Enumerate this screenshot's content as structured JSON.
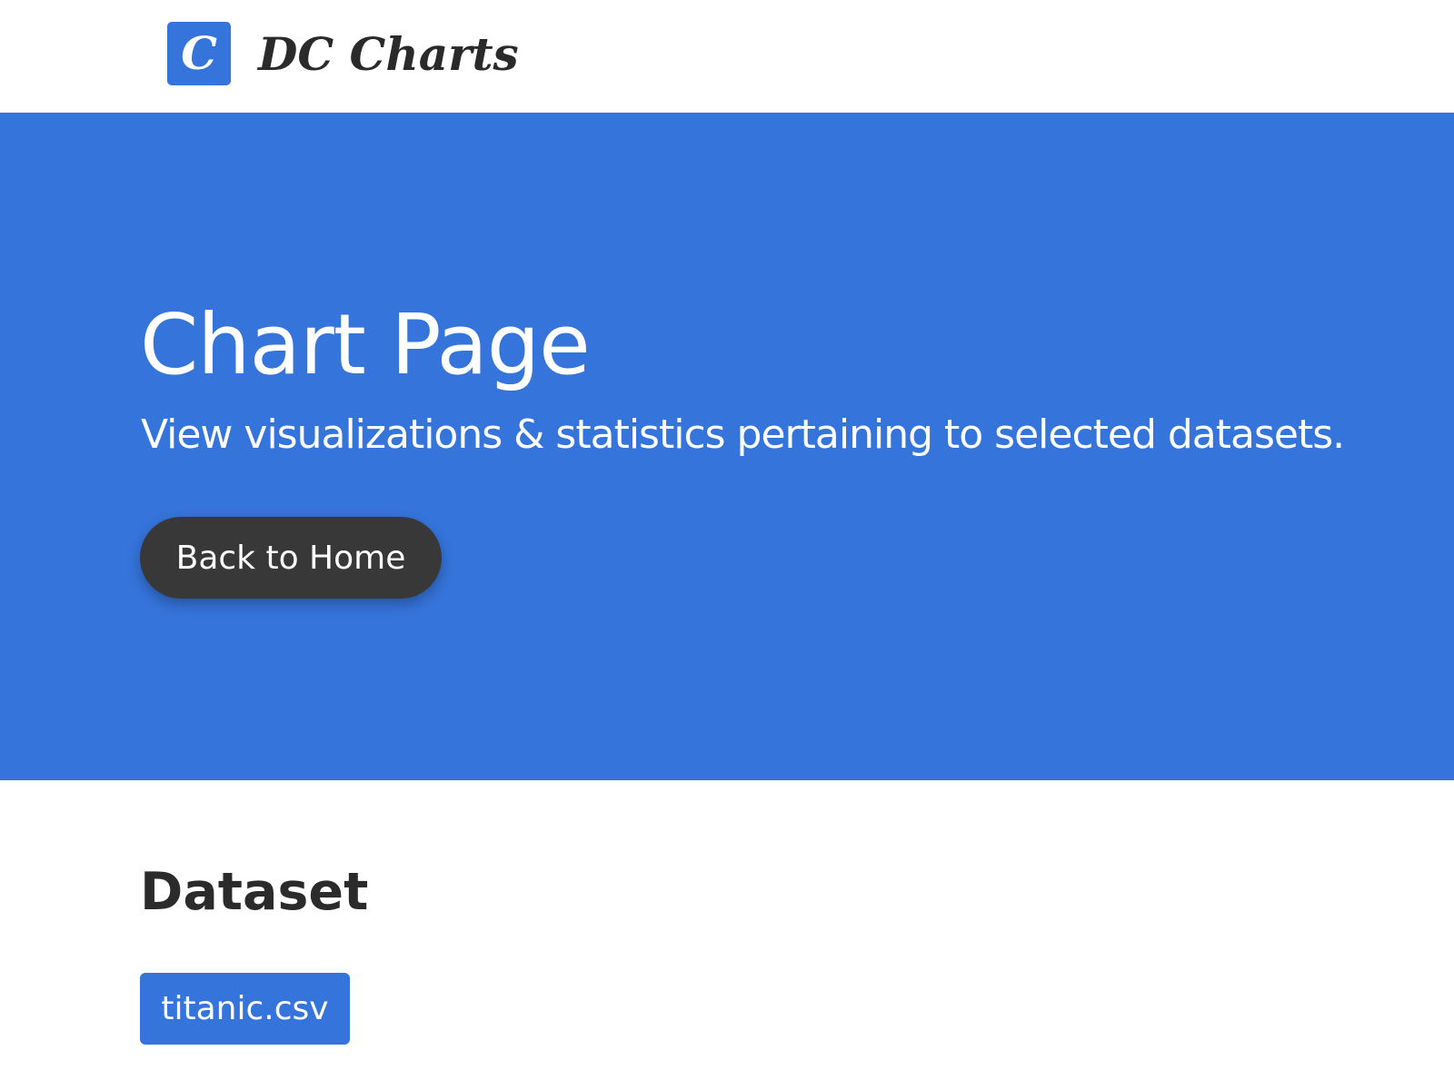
{
  "navbar": {
    "logo_letter": "C",
    "brand_name": "DC Charts"
  },
  "hero": {
    "title": "Chart Page",
    "subtitle": "View visualizations & statistics pertaining to selected datasets.",
    "home_button_label": "Back to Home"
  },
  "dataset": {
    "heading": "Dataset",
    "selected_file": "titanic.csv"
  },
  "colors": {
    "primary_blue": "#3574db",
    "dark_button": "#383838",
    "text_dark": "#2b2b2b",
    "white": "#ffffff"
  }
}
